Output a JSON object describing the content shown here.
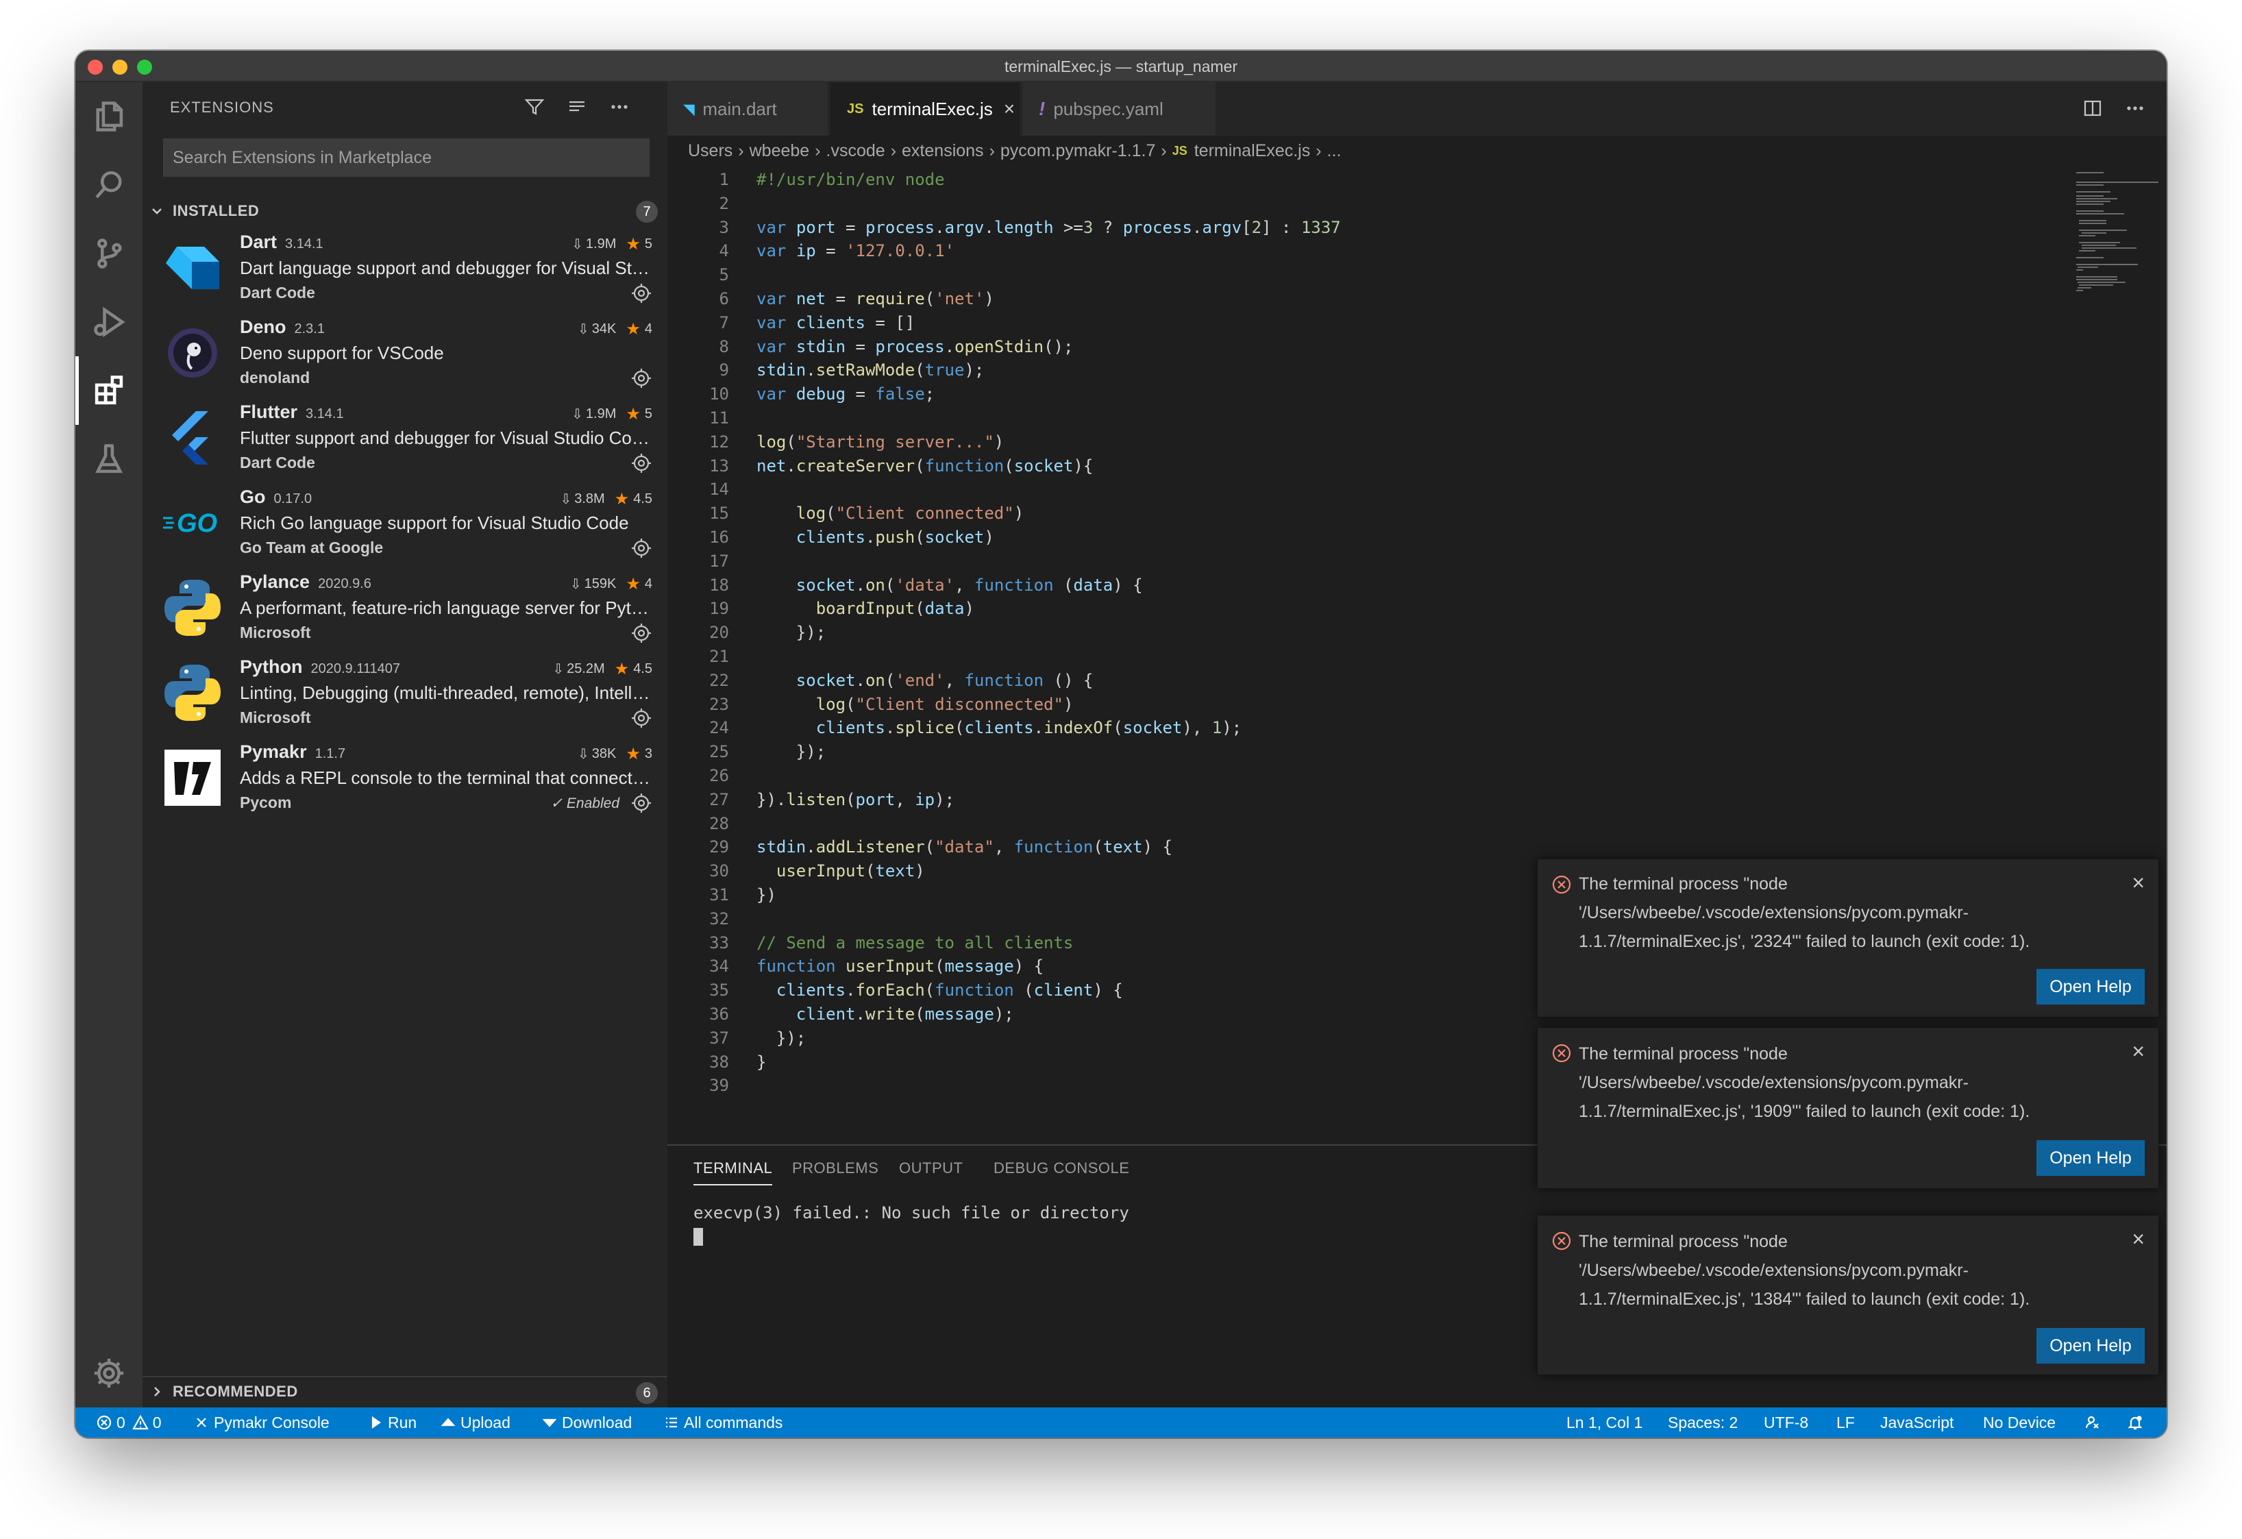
{
  "window": {
    "title": "terminalExec.js — startup_namer"
  },
  "activity_bar": [
    "explorer-icon",
    "search-icon",
    "source-control-icon",
    "run-debug-icon",
    "extensions-icon",
    "testing-icon",
    "settings-gear-icon"
  ],
  "sidebar": {
    "title": "EXTENSIONS",
    "search_placeholder": "Search Extensions in Marketplace",
    "installed": {
      "label": "INSTALLED",
      "count": "7",
      "items": [
        {
          "name": "Dart",
          "version": "3.14.1",
          "downloads": "1.9M",
          "rating": "5",
          "description": "Dart language support and debugger for Visual Studio Code.",
          "publisher": "Dart Code",
          "enabled_text": ""
        },
        {
          "name": "Deno",
          "version": "2.3.1",
          "downloads": "34K",
          "rating": "4",
          "description": "Deno support for VSCode",
          "publisher": "denoland",
          "enabled_text": ""
        },
        {
          "name": "Flutter",
          "version": "3.14.1",
          "downloads": "1.9M",
          "rating": "5",
          "description": "Flutter support and debugger for Visual Studio Code.",
          "publisher": "Dart Code",
          "enabled_text": ""
        },
        {
          "name": "Go",
          "version": "0.17.0",
          "downloads": "3.8M",
          "rating": "4.5",
          "description": "Rich Go language support for Visual Studio Code",
          "publisher": "Go Team at Google",
          "enabled_text": ""
        },
        {
          "name": "Pylance",
          "version": "2020.9.6",
          "downloads": "159K",
          "rating": "4",
          "description": "A performant, feature-rich language server for Python in VS Code",
          "publisher": "Microsoft",
          "enabled_text": ""
        },
        {
          "name": "Python",
          "version": "2020.9.111407",
          "downloads": "25.2M",
          "rating": "4.5",
          "description": "Linting, Debugging (multi-threaded, remote), Intellisense, Jupyter Notebooks",
          "publisher": "Microsoft",
          "enabled_text": ""
        },
        {
          "name": "Pymakr",
          "version": "1.1.7",
          "downloads": "38K",
          "rating": "3",
          "description": "Adds a REPL console to the terminal that connects to your Pycom board",
          "publisher": "Pycom",
          "enabled_text": "✓ Enabled"
        }
      ]
    },
    "recommended": {
      "label": "RECOMMENDED",
      "count": "6"
    }
  },
  "editor": {
    "tabs": [
      {
        "label": "main.dart",
        "icon": "◥",
        "active": false
      },
      {
        "label": "terminalExec.js",
        "icon": "JS",
        "active": true
      },
      {
        "label": "pubspec.yaml",
        "icon": "!",
        "active": false
      }
    ],
    "breadcrumb": [
      "Users",
      "wbeebe",
      ".vscode",
      "extensions",
      "pycom.pymakr-1.1.7",
      "terminalExec.js",
      "..."
    ],
    "lines": [
      "#!/usr/bin/env node",
      "",
      "var port = process.argv.length >=3 ? process.argv[2] : 1337",
      "var ip = '127.0.0.1'",
      "",
      "var net = require('net')",
      "var clients = []",
      "var stdin = process.openStdin();",
      "stdin.setRawMode(true);",
      "var debug = false;",
      "",
      "log(\"Starting server...\")",
      "net.createServer(function(socket){",
      "",
      "    log(\"Client connected\")",
      "    clients.push(socket)",
      "",
      "    socket.on('data', function (data) {",
      "      boardInput(data)",
      "    });",
      "",
      "    socket.on('end', function () {",
      "      log(\"Client disconnected\")",
      "      clients.splice(clients.indexOf(socket), 1);",
      "    });",
      "",
      "}).listen(port, ip);",
      "",
      "stdin.addListener(\"data\", function(text) {",
      "  userInput(text)",
      "})",
      "",
      "// Send a message to all clients",
      "function userInput(message) {",
      "  clients.forEach(function (client) {",
      "    client.write(message);",
      "  });",
      "}",
      ""
    ]
  },
  "panel": {
    "tabs": [
      "TERMINAL",
      "PROBLEMS",
      "OUTPUT",
      "DEBUG CONSOLE"
    ],
    "active_tab": "TERMINAL",
    "terminal_output": "execvp(3) failed.: No such file or directory"
  },
  "notifications": [
    {
      "line1": "The terminal process \"node",
      "line2": "'/Users/wbeebe/.vscode/extensions/pycom.pymakr-",
      "line3": "1.1.7/terminalExec.js', '2324'\" failed to launch (exit code: 1).",
      "button": "Open Help"
    },
    {
      "line1": "The terminal process \"node",
      "line2": "'/Users/wbeebe/.vscode/extensions/pycom.pymakr-",
      "line3": "1.1.7/terminalExec.js', '1909'\" failed to launch (exit code: 1).",
      "button": "Open Help"
    },
    {
      "line1": "The terminal process \"node",
      "line2": "'/Users/wbeebe/.vscode/extensions/pycom.pymakr-",
      "line3": "1.1.7/terminalExec.js', '1384'\" failed to launch (exit code: 1).",
      "button": "Open Help"
    }
  ],
  "status_bar": {
    "errors": "0",
    "warnings": "0",
    "pymakr_console": "Pymakr Console",
    "run": "Run",
    "upload": "Upload",
    "download": "Download",
    "all_commands": "All commands",
    "position": "Ln 1, Col 1",
    "spaces": "Spaces: 2",
    "encoding": "UTF-8",
    "eol": "LF",
    "language": "JavaScript",
    "device": "No Device"
  },
  "colors": {
    "accent": "#007acc",
    "button": "#0e639c",
    "error": "#f48771",
    "star": "#ff8e00"
  }
}
